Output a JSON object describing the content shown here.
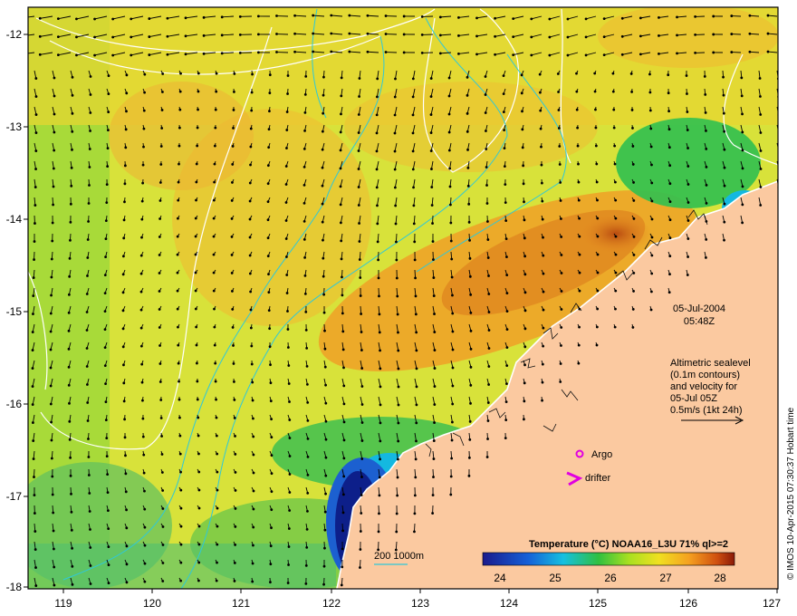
{
  "map": {
    "lon_ticks": [
      "119",
      "120",
      "121",
      "122",
      "123",
      "124",
      "125",
      "126",
      "127"
    ],
    "lat_ticks": [
      "-12",
      "-13",
      "-14",
      "-15",
      "-16",
      "-17",
      "-18"
    ]
  },
  "annotation": {
    "date": "05-Jul-2004",
    "time": "05:48Z",
    "sealevel_lines": [
      "Altimetric sealevel",
      "(0.1m contours)",
      "and velocity for",
      "05-Jul 05Z",
      "0.5m/s (1kt 24h)"
    ]
  },
  "legend": {
    "argo_label": "Argo",
    "drifter_label": "drifter",
    "depth_label": "200  1000m"
  },
  "colorbar": {
    "title": "Temperature (°C) NOAA16_L3U 71% ql>=2",
    "ticks": [
      "24",
      "25",
      "26",
      "27",
      "28"
    ]
  },
  "credit": "© IMOS 10-Apr-2015 07:30:37 Hobart time",
  "colors": {
    "land": "#fbc9a0",
    "argo": "#e000e0",
    "depth_contour": "#2fc8d8",
    "sealevel_contour": "#ffffff"
  }
}
